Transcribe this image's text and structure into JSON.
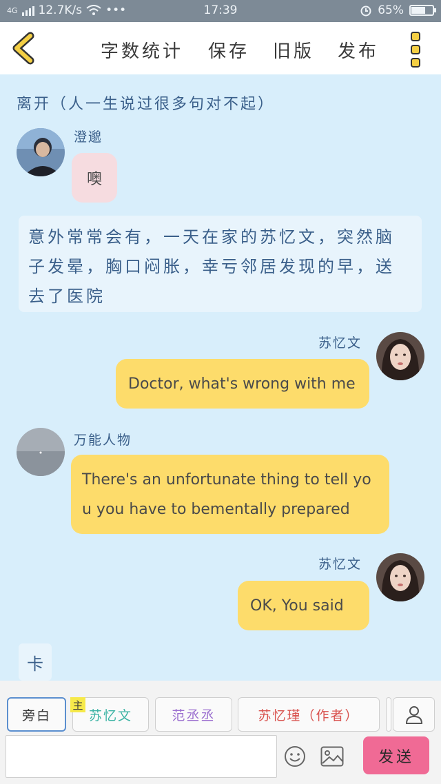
{
  "status_bar": {
    "network": "4G",
    "speed": "12.7K/s",
    "dots": "•••",
    "time": "17:39",
    "battery_percent": "65%",
    "battery_level": 0.65
  },
  "toolbar": {
    "word_count_label": "字数统计",
    "save_label": "保存",
    "old_version_label": "旧版",
    "publish_label": "发布"
  },
  "chat": {
    "title": "离开（人一生说过很多句对不起）",
    "messages": [
      {
        "speaker": "澄邈",
        "text": "噢"
      },
      {
        "narration": "意外常常会有，一天在家的苏忆文，突然脑子发晕，胸口闷胀，幸亏邻居发现的早，送去了医院"
      },
      {
        "speaker": "苏忆文",
        "text": "Doctor, what's wrong with me"
      },
      {
        "speaker": "万能人物",
        "line1": "There's an unfortunate thing to tell yo",
        "line2": "u you have to bementally prepared"
      },
      {
        "speaker": "苏忆文",
        "text": "OK,  You said"
      },
      {
        "narration": "卡"
      }
    ]
  },
  "input_bar": {
    "roles": [
      "旁白",
      "苏忆文",
      "范丞丞",
      "苏忆瑾（作者）"
    ],
    "main_tag": "主",
    "send_label": "发送",
    "role_colors": {
      "旁白": "#3a3a3a",
      "苏忆文": "#3bb3a4",
      "范丞丞": "#9b6fcf",
      "苏忆瑾（作者）": "#d9534f"
    }
  },
  "colors": {
    "accent": "#f06a95",
    "bubble_yellow": "#fddc6b",
    "bubble_pink": "#f6dce0",
    "background": "#d8eefb"
  }
}
